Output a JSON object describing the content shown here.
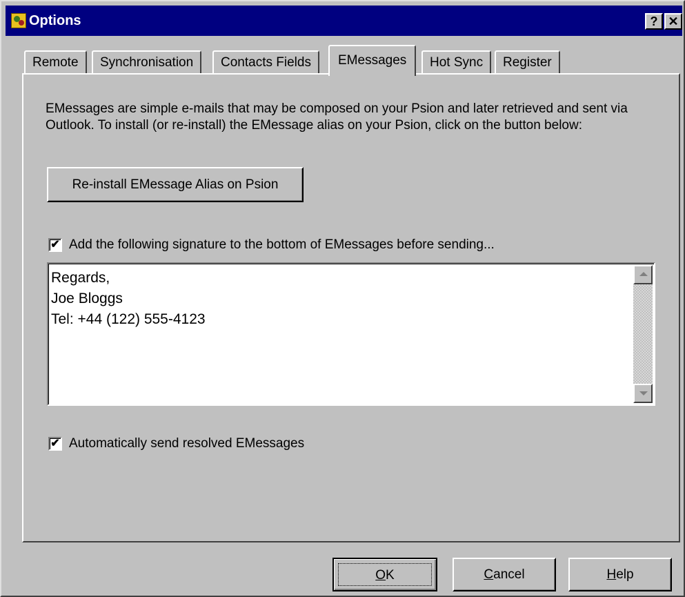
{
  "window": {
    "title": "Options",
    "help_glyph": "?",
    "close_glyph": "✕"
  },
  "tabs": [
    {
      "label": "Remote",
      "active": false
    },
    {
      "label": "Synchronisation",
      "active": false
    },
    {
      "label": "Contacts Fields",
      "active": false
    },
    {
      "label": "EMessages",
      "active": true
    },
    {
      "label": "Hot Sync",
      "active": false
    },
    {
      "label": "Register",
      "active": false
    }
  ],
  "panel": {
    "description": "EMessages are simple e-mails that may be composed on your Psion and later retrieved and sent via Outlook.  To install (or re-install) the EMessage alias on your Psion, click on the button below:",
    "reinstall_button": "Re-install EMessage Alias on Psion",
    "signature_checkbox": {
      "checked": true,
      "label": "Add the following signature to the bottom of EMessages before sending..."
    },
    "signature_lines": [
      "Regards,",
      "Joe Bloggs",
      "Tel: +44 (122) 555-4123"
    ],
    "auto_send_checkbox": {
      "checked": true,
      "label": "Automatically send resolved EMessages"
    }
  },
  "buttons": {
    "ok": {
      "mnemonic": "O",
      "rest": "K"
    },
    "cancel": {
      "mnemonic": "C",
      "rest": "ancel"
    },
    "help": {
      "mnemonic": "H",
      "rest": "elp"
    }
  },
  "check_glyph": "✔",
  "colors": {
    "titlebar": "#000080",
    "face": "#c0c0c0"
  }
}
